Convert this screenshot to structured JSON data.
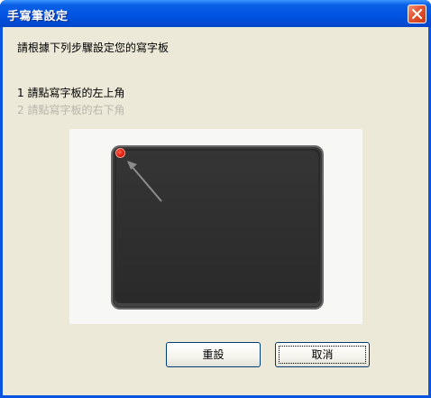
{
  "window": {
    "title": "手寫筆設定",
    "close_icon": "close-icon"
  },
  "content": {
    "instruction": "請根據下列步驟設定您的寫字板",
    "steps": [
      {
        "label": "1 請點寫字板的左上角",
        "state": "active"
      },
      {
        "label": "2 請點寫字板的右下角",
        "state": "inactive"
      }
    ]
  },
  "preview": {
    "target_marker": "red-dot-icon",
    "pointer": "arrow-icon"
  },
  "buttons": {
    "reset_label": "重設",
    "cancel_label": "取消"
  },
  "colors": {
    "titlebar": "#0053e1",
    "client": "#ece9d8",
    "tablet": "#2b2b2b",
    "marker": "#e01a0a",
    "inactive_text": "#b8b6ab"
  }
}
